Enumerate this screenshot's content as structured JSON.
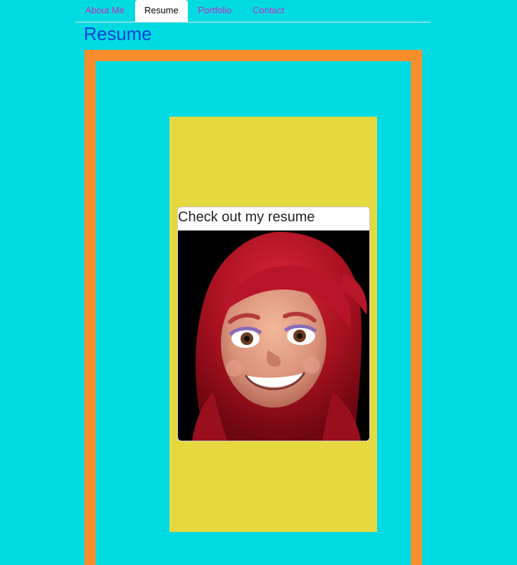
{
  "nav": {
    "tabs": [
      {
        "label": "About Me",
        "active": false
      },
      {
        "label": "Resume",
        "active": true
      },
      {
        "label": "Portfolio",
        "active": false
      },
      {
        "label": "Contact",
        "active": false
      }
    ]
  },
  "page": {
    "title": "Resume"
  },
  "resume_card": {
    "title": "Check out my resume",
    "image_alt": "memoji-avatar-red-hair"
  },
  "colors": {
    "background": "#00dbe2",
    "frame": "#f98d2d",
    "yellow_box": "#e6d93f",
    "link": "#c82cc4",
    "title": "#0d41d6"
  }
}
